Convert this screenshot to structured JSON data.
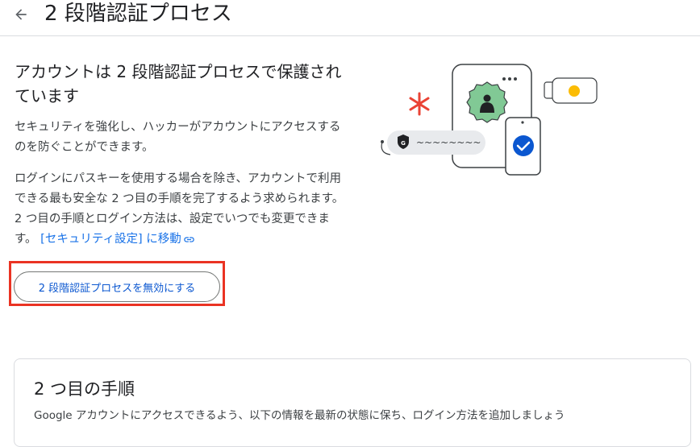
{
  "header": {
    "title": "2 段階認証プロセス",
    "back_icon": "arrow-back-icon"
  },
  "intro": {
    "title": "アカウントは 2 段階認証プロセスで保護されています",
    "paragraph1": "セキュリティを強化し、ハッカーがアカウントにアクセスするのを防ぐことができます。",
    "paragraph2": "ログインにパスキーを使用する場合を除き、アカウントで利用できる最も安全な 2 つ目の手順を完了するよう求められます。2 つ目の手順とログイン方法は、設定でいつでも変更できます。",
    "link_text": "[セキュリティ設定] に移動",
    "link_icon": "link-icon",
    "disable_button": "2 段階認証プロセスを無効にする"
  },
  "illustration": {
    "password_mask": "~~~~~~~~",
    "shield_letter": "G",
    "colors": {
      "green": "#81c995",
      "blue": "#0b57d0",
      "red": "#ea4335",
      "yellow": "#fbbc04",
      "gray": "#e8eaed"
    }
  },
  "second_steps": {
    "title": "2 つ目の手順",
    "description": "Google アカウントにアクセスできるよう、以下の情報を最新の状態に保ち、ログイン方法を追加しましょう"
  },
  "colors": {
    "accent": "#1a73e8",
    "button_text": "#0b57d0",
    "highlight": "#ea3323"
  }
}
